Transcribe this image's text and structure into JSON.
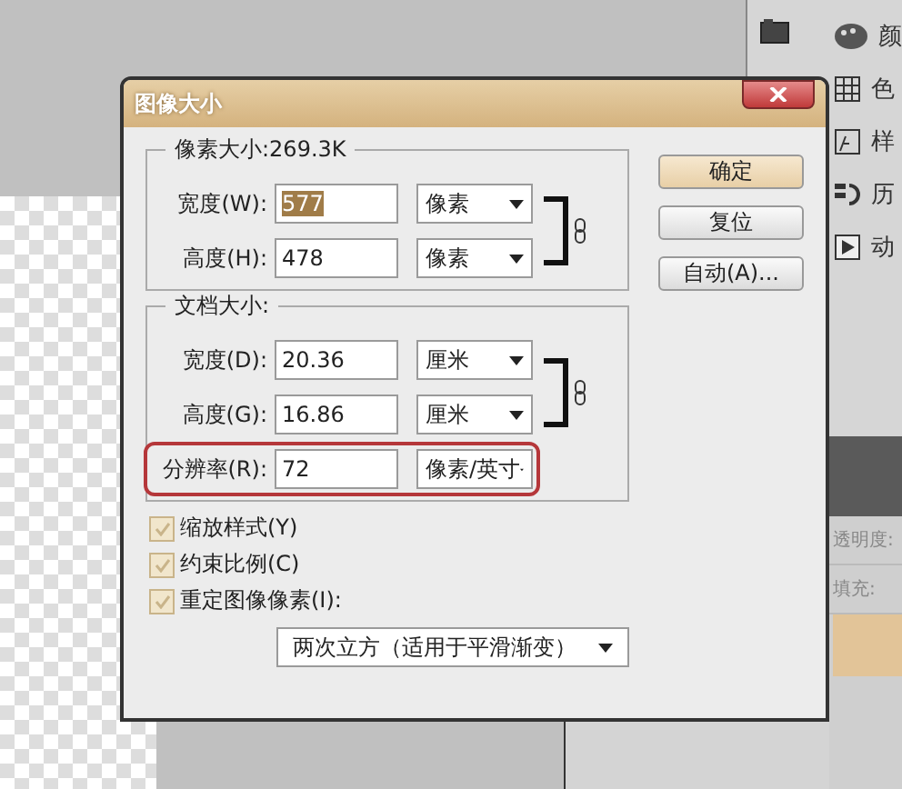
{
  "panel_items": [
    {
      "label": "颜"
    },
    {
      "label": "色"
    },
    {
      "label": "样"
    },
    {
      "label": "历"
    },
    {
      "label": "动"
    }
  ],
  "layer_fields": [
    "透明度:",
    "填充:"
  ],
  "dialog": {
    "title": "图像大小",
    "pixel_group": {
      "title": "像素大小:269.3K",
      "rows": [
        {
          "label": "宽度(W):",
          "value": "577",
          "unit": "像素",
          "selected": true
        },
        {
          "label": "高度(H):",
          "value": "478",
          "unit": "像素",
          "selected": false
        }
      ]
    },
    "doc_group": {
      "title": "文档大小:",
      "rows": [
        {
          "label": "宽度(D):",
          "value": "20.36",
          "unit": "厘米",
          "highlighted": false
        },
        {
          "label": "高度(G):",
          "value": "16.86",
          "unit": "厘米",
          "highlighted": false
        },
        {
          "label": "分辨率(R):",
          "value": "72",
          "unit": "像素/英寸",
          "highlighted": true
        }
      ]
    },
    "buttons": [
      {
        "label": "确定",
        "default": true
      },
      {
        "label": "复位",
        "default": false
      },
      {
        "label": "自动(A)...",
        "default": false
      }
    ],
    "checkboxes": [
      {
        "label": "缩放样式(Y)",
        "checked": true
      },
      {
        "label": "约束比例(C)",
        "checked": true
      },
      {
        "label": "重定图像像素(I):",
        "checked": true
      }
    ],
    "resample": "两次立方（适用于平滑渐变）"
  }
}
